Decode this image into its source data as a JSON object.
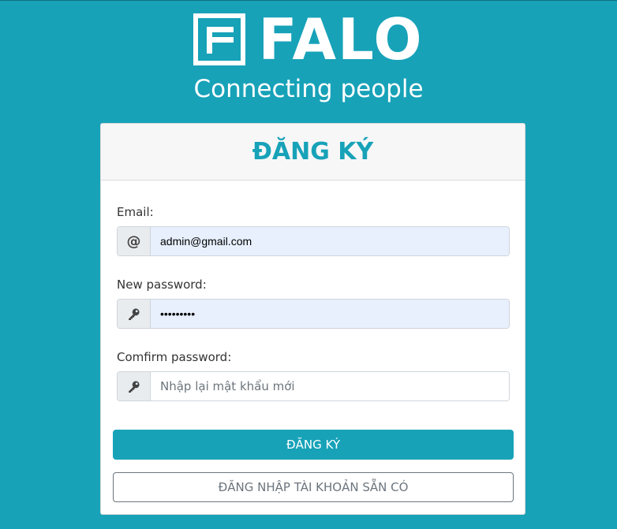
{
  "brand": {
    "name": "FALO",
    "tagline": "Connecting people"
  },
  "form": {
    "title": "ĐĂNG KÝ",
    "email": {
      "label": "Email:",
      "icon": "at-icon",
      "icon_glyph": "@",
      "value": "admin@gmail.com",
      "placeholder": ""
    },
    "new_password": {
      "label": "New password:",
      "icon": "key-icon",
      "value": "123456789",
      "placeholder": ""
    },
    "confirm_password": {
      "label": "Comfirm password:",
      "icon": "key-icon",
      "value": "",
      "placeholder": "Nhập lại mật khẩu mới"
    },
    "submit_label": "ĐĂNG KÝ",
    "login_label": "ĐĂNG NHẬP TÀI KHOẢN SẴN CÓ"
  },
  "colors": {
    "background": "#17a2b8",
    "accent": "#17a2b8",
    "autofill": "#e8f0fe"
  }
}
